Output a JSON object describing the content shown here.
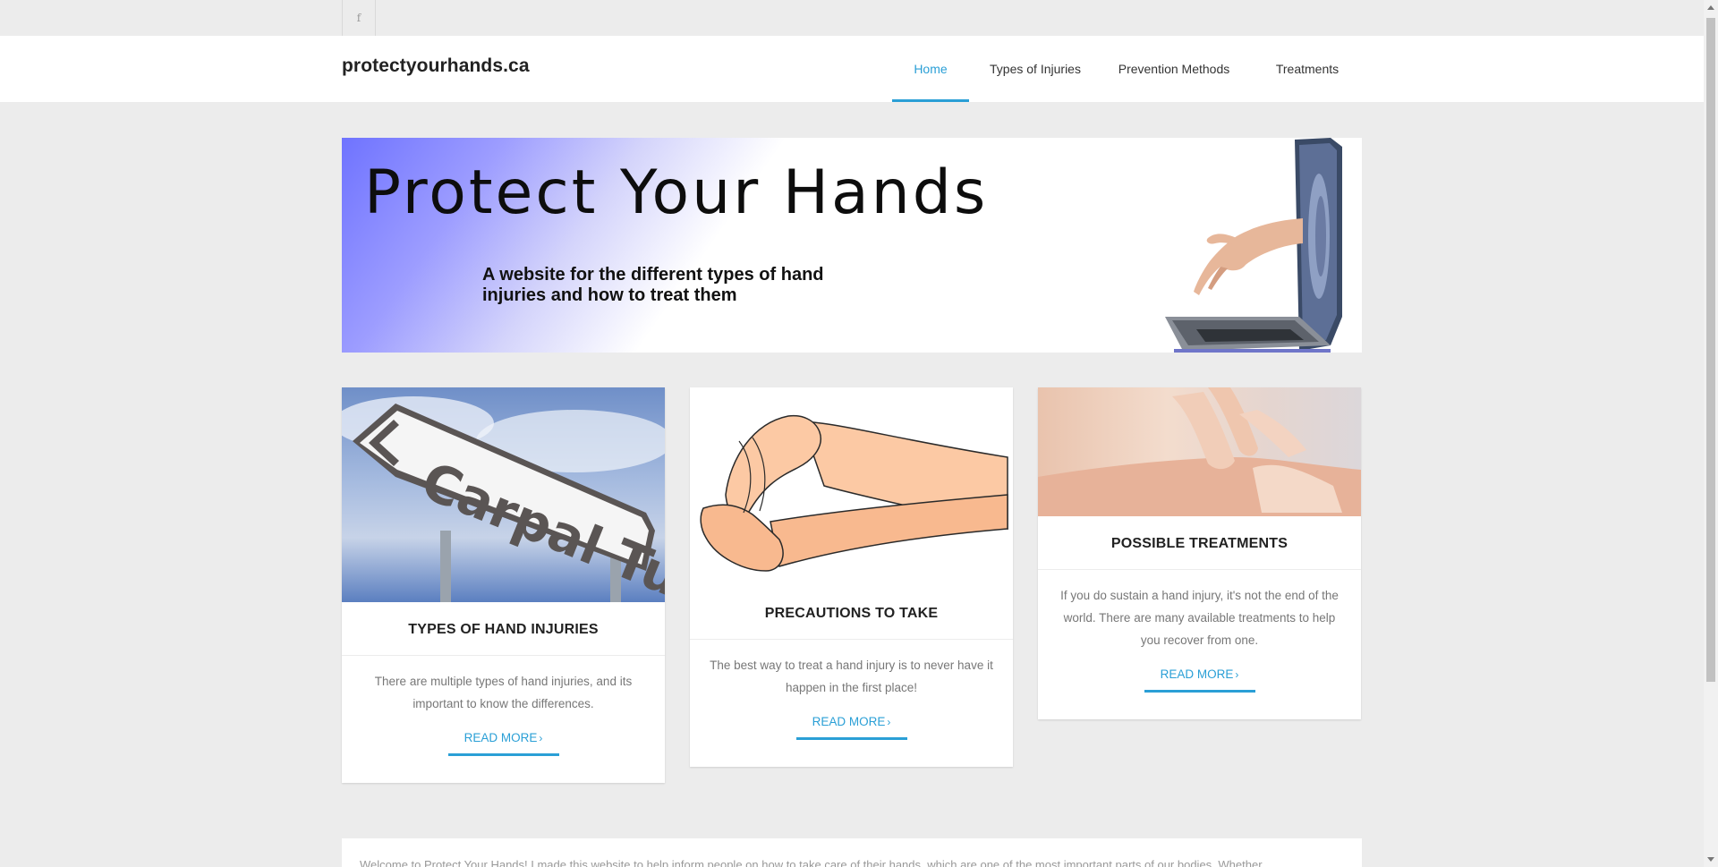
{
  "social": {
    "facebook_icon": "facebook-icon",
    "facebook_glyph": "f"
  },
  "header": {
    "logo": "protectyourhands.ca"
  },
  "nav": {
    "items": [
      {
        "label": "Home",
        "active": true
      },
      {
        "label": "Types of Injuries",
        "active": false
      },
      {
        "label": "Prevention Methods",
        "active": false
      },
      {
        "label": "Treatments",
        "active": false
      }
    ]
  },
  "banner": {
    "title": "Protect Your Hands",
    "subtitle": "A website for the different types of hand injuries and how to treat them",
    "image_icon": "laptop-hand-icon"
  },
  "cards": [
    {
      "image_text": "Carpal Tunnel",
      "title": "TYPES OF HAND INJURIES",
      "text": "There are multiple types of hand injuries, and its important to know the differences.",
      "link": "READ MORE"
    },
    {
      "title": "PRECAUTIONS TO TAKE",
      "text": "The best way to treat a hand injury is to never have it happen in the first place!",
      "link": "READ MORE"
    },
    {
      "title": "POSSIBLE TREATMENTS",
      "text": "If you do sustain a hand injury, it's not the end of the world. There are many available treatments to help you recover from one.",
      "link": "READ MORE"
    }
  ],
  "intro": {
    "text": "Welcome to Protect Your Hands! I made this website to help inform people on how to take care of their hands, which are one of the most important parts of our bodies. Whether"
  },
  "colors": {
    "accent": "#2a9fd6",
    "background": "#ececec"
  }
}
